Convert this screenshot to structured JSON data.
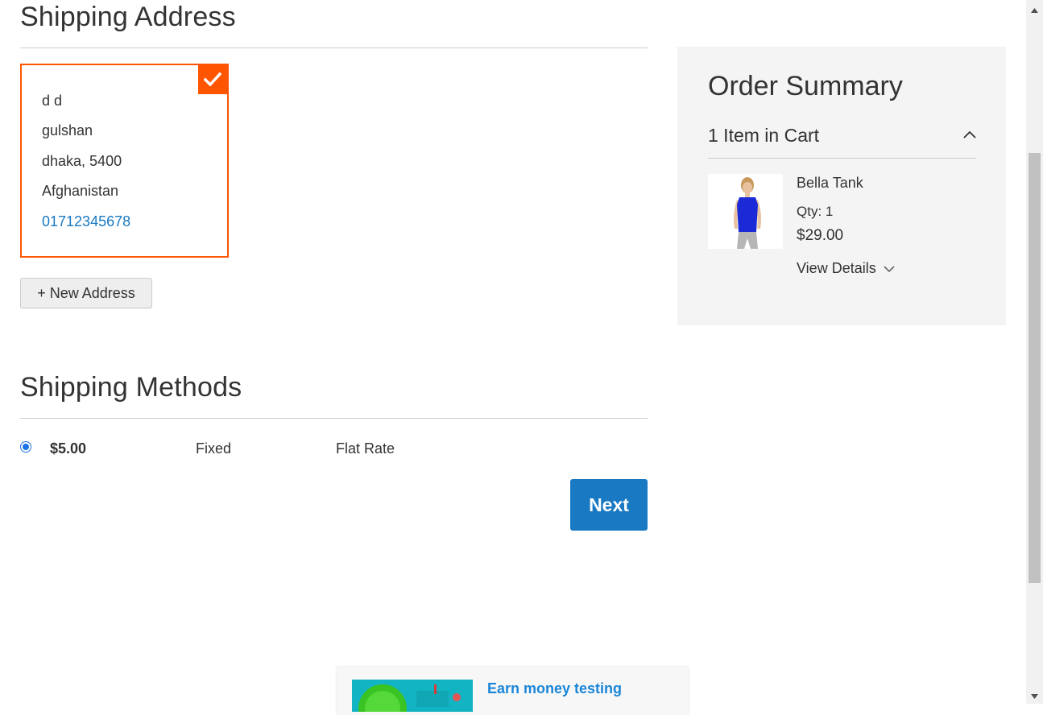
{
  "shipping_address": {
    "title": "Shipping Address",
    "address": {
      "name": "d d",
      "street": "gulshan",
      "city_zip": "dhaka, 5400",
      "country": "Afghanistan",
      "phone": "01712345678"
    },
    "new_address_label": "+ New Address"
  },
  "shipping_methods": {
    "title": "Shipping Methods",
    "methods": [
      {
        "price": "$5.00",
        "method": "Fixed",
        "carrier": "Flat Rate",
        "selected": true
      }
    ],
    "next_label": "Next"
  },
  "order_summary": {
    "title": "Order Summary",
    "cart_count": "1 Item in Cart",
    "items": [
      {
        "name": "Bella Tank",
        "qty": "Qty: 1",
        "price": "$29.00",
        "view_details": "View Details"
      }
    ]
  },
  "ad": {
    "text": "Earn money testing"
  },
  "colors": {
    "accent_orange": "#ff5501",
    "primary_blue": "#1979c3",
    "link_blue": "#1979c3",
    "summary_bg": "#f4f4f4"
  },
  "icons": {
    "selected_check": "checkmark-icon",
    "collapse": "chevron-up-icon",
    "expand": "chevron-down-icon"
  }
}
